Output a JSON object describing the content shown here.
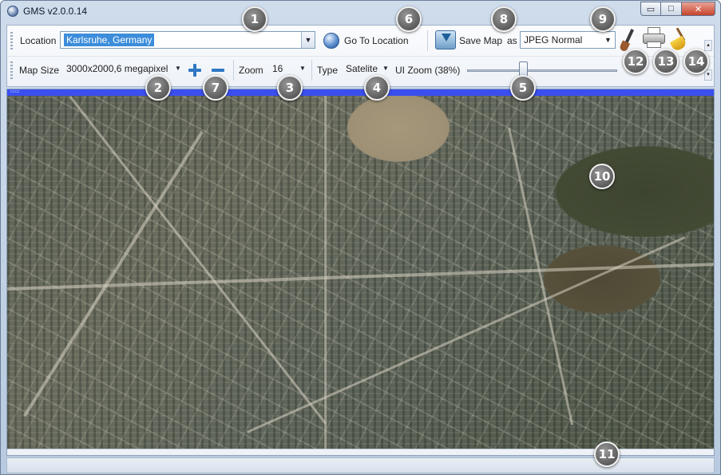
{
  "window": {
    "title": "GMS v2.0.0.14",
    "controls": {
      "minimize": "▭",
      "maximize": "□",
      "close": "✕"
    }
  },
  "toolbar": {
    "location_label": "Location",
    "location_value": "Karlsruhe, Germany",
    "goto_label": "Go To Location",
    "save_label": "Save Map",
    "as_label": "as",
    "format_value": "JPEG Normal",
    "mapsize_label": "Map Size",
    "mapsize_value": "3000x2000,6 megapixel",
    "zoom_label": "Zoom",
    "zoom_value": "16",
    "type_label": "Type",
    "type_value": "Satelite",
    "uizoom_label": "UI Zoom (38%)",
    "uizoom_level": 0.38
  },
  "map": {
    "type": "satellite",
    "location": "Karlsruhe, Germany"
  },
  "callouts": [
    "1",
    "2",
    "3",
    "4",
    "5",
    "6",
    "7",
    "8",
    "9",
    "10",
    "11",
    "12",
    "13",
    "14"
  ],
  "icons": {
    "app": "globe-icon",
    "goto": "globe-icon",
    "save": "save-download-icon",
    "zoom_in": "plus-icon",
    "zoom_out": "minus-icon",
    "paint": "brush-icon",
    "print": "printer-icon",
    "clear": "broom-icon"
  },
  "colors": {
    "selection": "#3c8ddb",
    "map_top_bar": "#3b4ff0",
    "zoom_buttons": "#2f78c4",
    "callout": "#5c5c5c"
  }
}
